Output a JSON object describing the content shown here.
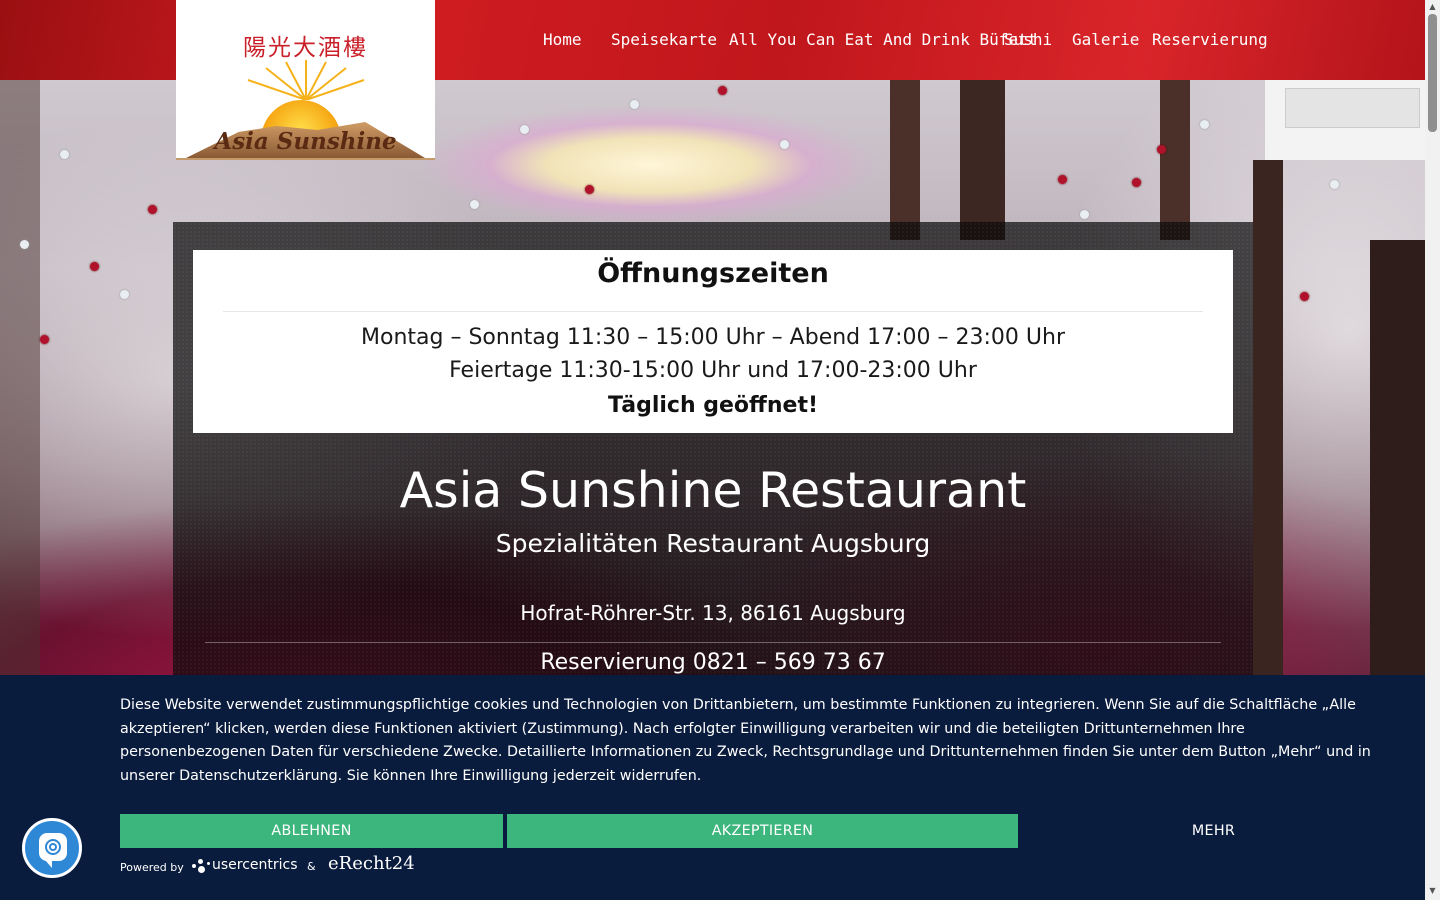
{
  "header": {
    "logo": {
      "chinese": "陽光大酒樓",
      "name": "Asia Sunshine"
    },
    "nav": [
      {
        "label": "Home"
      },
      {
        "label": "Speisekarte"
      },
      {
        "label": "All You Can Eat And Drink Büfett"
      },
      {
        "label": "Sushi"
      },
      {
        "label": "Galerie"
      },
      {
        "label": "Reservierung"
      }
    ]
  },
  "hours": {
    "title": "Öffnungszeiten",
    "line1": "Montag – Sonntag 11:30 – 15:00 Uhr – Abend 17:00 – 23:00 Uhr",
    "line2": "Feiertage 11:30-15:00 Uhr und 17:00-23:00 Uhr",
    "line3": "Täglich geöffnet!"
  },
  "hero": {
    "title": "Asia Sunshine Restaurant",
    "subtitle": "Spezialitäten Restaurant Augsburg",
    "address": "Hofrat-Röhrer-Str. 13, 86161 Augsburg",
    "phone": "Reservierung 0821 – 569 73 67"
  },
  "cookie": {
    "text": "Diese Website verwendet zustimmungspflichtige cookies und Technologien von Drittanbietern, um bestimmte Funktionen zu integrieren. Wenn Sie auf die Schaltfläche „Alle akzeptieren“ klicken, werden diese Funktionen aktiviert (Zustimmung). Nach erfolgter Einwilligung verarbeiten wir und die beteiligten Drittunternehmen Ihre personenbezogenen Daten für verschiedene Zwecke. Detaillierte Informationen zu Zweck, Rechtsgrundlage und Drittunternehmen finden Sie unter dem Button „Mehr“ und in unserer Datenschutzerklärung. Sie können Ihre Einwilligung jederzeit widerrufen.",
    "deny_label": "ABLEHNEN",
    "accept_label": "AKZEPTIEREN",
    "more_label": "MEHR",
    "powered_by": "Powered by",
    "usercentrics": "usercentrics",
    "amp": "&",
    "erecht": "eRecht24"
  },
  "colors": {
    "header_red": "#c0171c",
    "banner_navy": "#0a1c3d",
    "button_green": "#3db67e",
    "privacy_button_blue": "#2f88d6"
  },
  "icons": {
    "privacy": "fingerprint-chat-icon",
    "scroll_up": "triangle-up-icon",
    "scroll_down": "triangle-down-icon"
  }
}
